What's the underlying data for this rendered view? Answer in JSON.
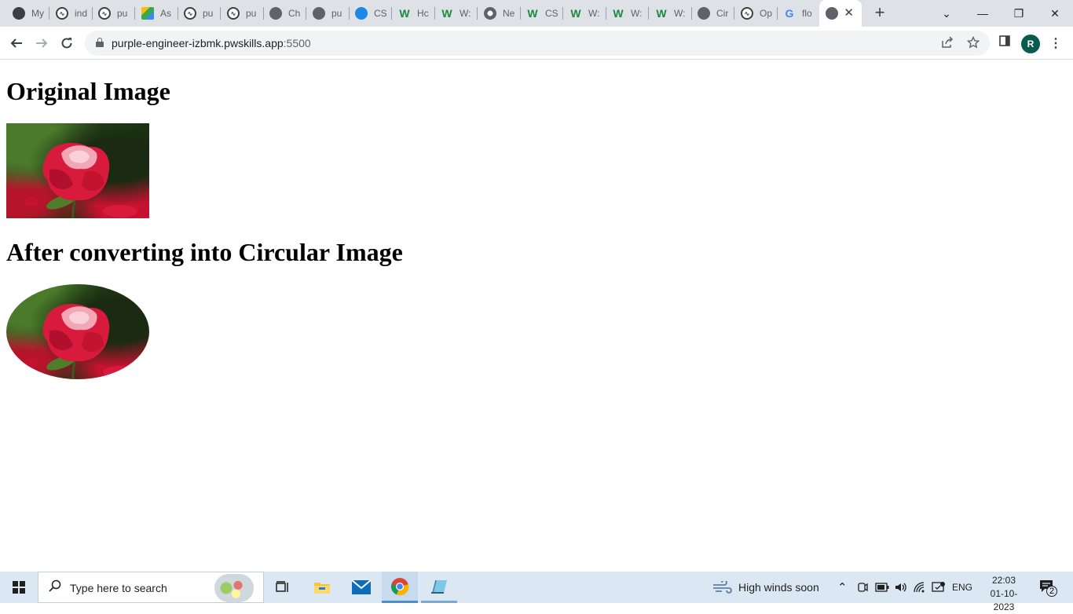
{
  "browser": {
    "tabs": [
      {
        "title": "My",
        "favicon": "wordpress-icon"
      },
      {
        "title": "ind",
        "favicon": "openai-icon"
      },
      {
        "title": "pu",
        "favicon": "openai-icon"
      },
      {
        "title": "As",
        "favicon": "google-drive-icon"
      },
      {
        "title": "pu",
        "favicon": "openai-icon"
      },
      {
        "title": "pu",
        "favicon": "openai-icon"
      },
      {
        "title": "Ch",
        "favicon": "globe-icon"
      },
      {
        "title": "pu",
        "favicon": "globe-icon"
      },
      {
        "title": "CS",
        "favicon": "lp-icon"
      },
      {
        "title": "Hc",
        "favicon": "w-icon"
      },
      {
        "title": "W:",
        "favicon": "w-icon"
      },
      {
        "title": "Ne",
        "favicon": "chrome-icon"
      },
      {
        "title": "CS",
        "favicon": "w-icon"
      },
      {
        "title": "W:",
        "favicon": "w-icon"
      },
      {
        "title": "W:",
        "favicon": "w-icon"
      },
      {
        "title": "W:",
        "favicon": "w-icon"
      },
      {
        "title": "Cir",
        "favicon": "globe-icon"
      },
      {
        "title": "Op",
        "favicon": "openai-icon"
      },
      {
        "title": "flo",
        "favicon": "google-icon"
      }
    ],
    "active_tab": {
      "title": "",
      "favicon": "globe-icon",
      "close_glyph": "✕"
    },
    "new_tab_glyph": "+",
    "window_controls": {
      "tab_search": "⌄",
      "minimize": "—",
      "restore": "❐",
      "close": "✕"
    },
    "address": {
      "host": "purple-engineer-izbmk.pwskills.app",
      "port": ":5500"
    },
    "profile_initial": "R"
  },
  "page": {
    "heading_original": "Original Image",
    "heading_circular": "After converting into Circular Image"
  },
  "taskbar": {
    "search_placeholder": "Type here to search",
    "weather_text": "High winds soon",
    "language": "ENG",
    "time": "22:03",
    "date": "01-10-2023",
    "notification_count": "2"
  },
  "colors": {
    "tabstrip_bg": "#dee1e6",
    "accent_profile": "#0b5a4e",
    "rose_red": "#d81b3c",
    "taskbar_bg": "#dbe7f2"
  }
}
